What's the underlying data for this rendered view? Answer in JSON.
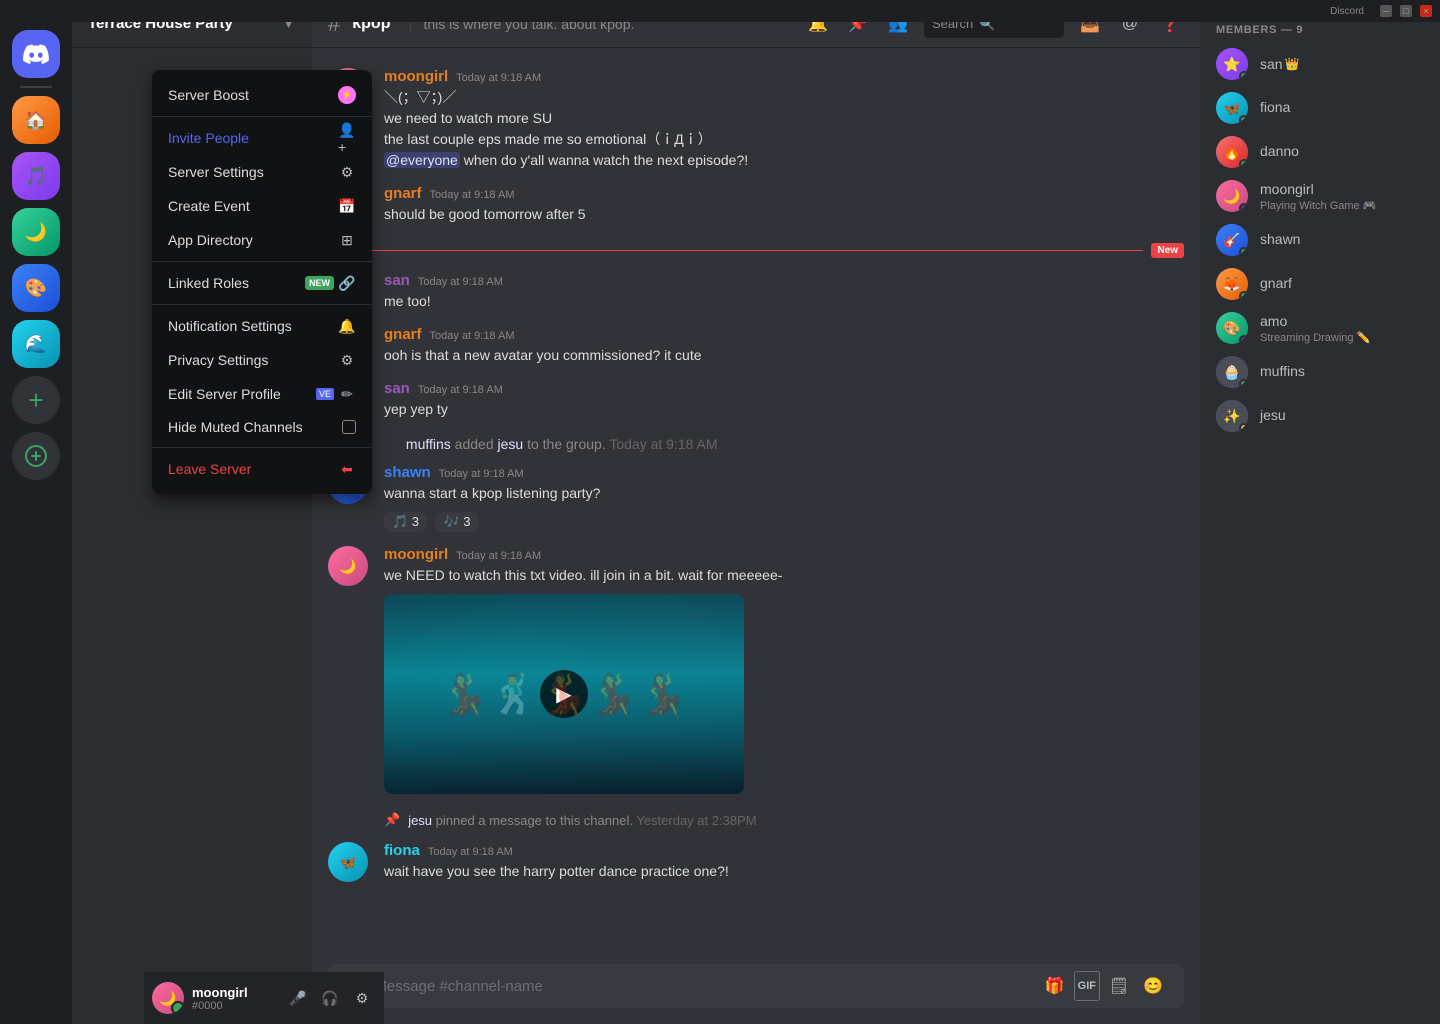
{
  "app": {
    "title": "Discord"
  },
  "titlebar": {
    "minimize": "─",
    "maximize": "□",
    "close": "×"
  },
  "server": {
    "name": "Terrace House Party",
    "channel": {
      "name": "kpop",
      "description": "this is where you talk. about kpop."
    }
  },
  "context_menu": {
    "items": [
      {
        "id": "server-boost",
        "label": "Server Boost",
        "icon": "boost",
        "right": "boost-icon",
        "active": false,
        "danger": false
      },
      {
        "id": "invite-people",
        "label": "Invite People",
        "icon": "person-add",
        "active": true,
        "danger": false
      },
      {
        "id": "server-settings",
        "label": "Server Settings",
        "icon": "gear",
        "active": false,
        "danger": false
      },
      {
        "id": "create-event",
        "label": "Create Event",
        "icon": "calendar",
        "active": false,
        "danger": false
      },
      {
        "id": "app-directory",
        "label": "App Directory",
        "icon": "grid",
        "active": false,
        "danger": false
      },
      {
        "id": "linked-roles",
        "label": "Linked Roles",
        "icon": "link",
        "badge": "NEW",
        "active": false,
        "danger": false
      },
      {
        "id": "notification-settings",
        "label": "Notification Settings",
        "icon": "bell",
        "active": false,
        "danger": false
      },
      {
        "id": "privacy-settings",
        "label": "Privacy Settings",
        "icon": "gear",
        "active": false,
        "danger": false
      },
      {
        "id": "edit-server-profile",
        "label": "Edit Server Profile",
        "icon": "pencil",
        "badge_ve": "VE",
        "active": false,
        "danger": false
      },
      {
        "id": "hide-muted-channels",
        "label": "Hide Muted Channels",
        "icon": "checkbox",
        "active": false,
        "danger": false
      },
      {
        "id": "leave-server",
        "label": "Leave Server",
        "icon": "exit",
        "active": false,
        "danger": true
      }
    ]
  },
  "messages": [
    {
      "id": "m1",
      "user": "moongirl",
      "avatar_class": "av-pink",
      "avatar_emoji": "🌙",
      "time": "Today at 9:18 AM",
      "lines": [
        "＼(；▽；)／",
        "we need to watch more SU",
        "the last couple eps made me so emotional（ｉДｉ）",
        "@everyone when do y'all wanna watch the next episode?!"
      ],
      "has_mention": true
    },
    {
      "id": "m2",
      "user": "gnarf",
      "avatar_class": "av-orange",
      "avatar_emoji": "🦊",
      "time": "Today at 9:18 AM",
      "lines": [
        "should be good tomorrow after 5"
      ]
    },
    {
      "id": "m3",
      "user": "san",
      "avatar_class": "av-purple",
      "avatar_emoji": "⭐",
      "time": "Today at 9:18 AM",
      "lines": [
        "me too!"
      ],
      "is_new": true
    },
    {
      "id": "m4",
      "user": "gnarf",
      "avatar_class": "av-orange",
      "avatar_emoji": "🦊",
      "time": "Today at 9:18 AM",
      "lines": [
        "ooh is that a new avatar you commissioned? it cute"
      ]
    },
    {
      "id": "m5",
      "user": "san",
      "avatar_class": "av-purple",
      "avatar_emoji": "⭐",
      "time": "Today at 9:18 AM",
      "lines": [
        "yep yep ty"
      ]
    },
    {
      "id": "sys1",
      "type": "system",
      "text": "muffins added jesu to the group.",
      "time": "Today at 9:18 AM"
    },
    {
      "id": "m6",
      "user": "shawn",
      "avatar_class": "av-blue",
      "avatar_emoji": "🎸",
      "time": "Today at 9:18 AM",
      "lines": [
        "wanna start a kpop listening party?"
      ],
      "reactions": [
        {
          "emoji": "🎵",
          "count": "3"
        },
        {
          "emoji": "🎶",
          "count": "3"
        }
      ]
    },
    {
      "id": "m7",
      "user": "moongirl",
      "avatar_class": "av-pink",
      "avatar_emoji": "🌙",
      "time": "Today at 9:18 AM",
      "lines": [
        "we NEED to watch this txt video. ill join in a bit. wait for meeeee-"
      ],
      "has_video": true
    },
    {
      "id": "pin1",
      "type": "pin",
      "user": "jesu",
      "time": "Yesterday at 2:38PM"
    },
    {
      "id": "m8",
      "user": "fiona",
      "avatar_class": "av-teal",
      "avatar_emoji": "🦋",
      "time": "Today at 9:18 AM",
      "lines": [
        "wait have you see the harry potter dance practice one?!"
      ]
    }
  ],
  "members": {
    "header": "MEMBERS — 9",
    "list": [
      {
        "name": "san",
        "has_crown": true,
        "status": "online",
        "avatar_class": "av-purple",
        "emoji": "⭐"
      },
      {
        "name": "fiona",
        "status": "online",
        "avatar_class": "av-teal",
        "emoji": "🦋"
      },
      {
        "name": "danno",
        "status": "online",
        "avatar_class": "av-red",
        "emoji": "🔥"
      },
      {
        "name": "moongirl",
        "status": "streaming",
        "sub_status": "Playing Witch Game 🎮",
        "avatar_class": "av-pink",
        "emoji": "🌙"
      },
      {
        "name": "shawn",
        "status": "online",
        "avatar_class": "av-blue",
        "emoji": "🎸"
      },
      {
        "name": "gnarf",
        "status": "online",
        "avatar_class": "av-orange",
        "emoji": "🦊"
      },
      {
        "name": "amo",
        "status": "streaming",
        "sub_status": "Streaming Drawing ✏️",
        "avatar_class": "av-green",
        "emoji": "🎨"
      },
      {
        "name": "muffins",
        "status": "online",
        "avatar_class": "av-dark",
        "emoji": "🧁"
      },
      {
        "name": "jesu",
        "status": "idle",
        "avatar_class": "av-dark",
        "emoji": "✨"
      }
    ]
  },
  "user": {
    "name": "moongirl",
    "tag": "#0000",
    "avatar_class": "av-pink",
    "avatar_emoji": "🌙"
  },
  "input": {
    "placeholder": "Message #channel-name"
  },
  "search": {
    "placeholder": "Search"
  }
}
